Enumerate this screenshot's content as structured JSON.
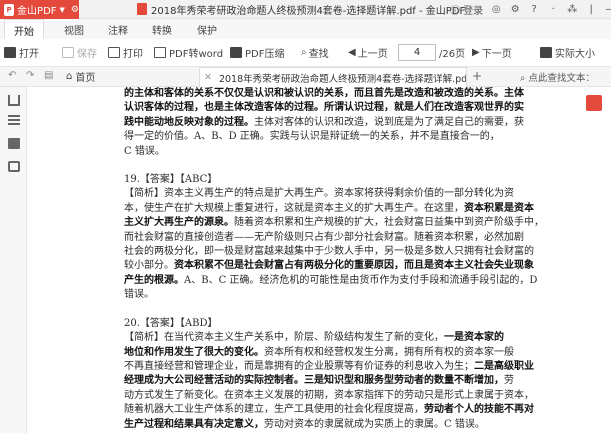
{
  "app": {
    "brand": "金山PDF",
    "window_title": "2018年秀荣考研政治命题人终极预测4套卷-选择题详解.pdf - 金山PDF",
    "login": "登录",
    "window_controls": [
      "◎",
      "⚙",
      "?",
      "·",
      "⁂",
      "|",
      "—",
      "□",
      "✕"
    ]
  },
  "menu": [
    "开始",
    "视图",
    "注释",
    "转换",
    "保护"
  ],
  "toolbar": {
    "open": "打开",
    "save": "保存",
    "print": "打印",
    "pdf2word": "PDF转word",
    "compress": "PDF压缩",
    "find": "查找",
    "prev": "上一页",
    "page_current": "4",
    "page_total": "/26页",
    "next": "下一页",
    "actual_size": "实际大小"
  },
  "tabs": {
    "home": "首页",
    "doc": "2018年秀荣考研政治命题人终极预测4套卷-选择题详解.pdf",
    "search_placeholder": "点此查找文本："
  },
  "document": {
    "q18_cont": [
      {
        "b": "的主体和客体的关系不仅仅是认识和被认识的关系，而且首先是改造和被改造的关系。主体"
      },
      {
        "b": "认识客体的过程，也是主体改造客体的过程。所谓认识过程，就是人们在改造客观世界的实"
      },
      {
        "b": "践中能动地反映对象的过程。",
        "t": "主体对客体的认识和改造，说到底是为了满足自己的需要，获"
      },
      {
        "t": "得一定的价值。A、B、D 正确。实践与认识是辩证统一的关系，并不是直接合一的，"
      },
      {
        "t": "C 错误。"
      }
    ],
    "q19_head": "19.【答案】【ABC】",
    "q19": [
      {
        "t": "【简析】资本主义再生产的特点是扩大再生产。资本家将获得剩余价值的一部分转化为资"
      },
      {
        "t": "本，使生产在扩大规模上重复进行，这就是资本主义的扩大再生产。在这里，",
        "b": "资本积累是资本"
      },
      {
        "b": "主义扩大再生产的源泉。",
        "t": "随着资本积累和生产规模的扩大，社会财富日益集中到资产阶级手中，"
      },
      {
        "t": "而社会财富的直接创造者——无产阶级则只占有少部分社会财富。随着资本积累，必然加剧"
      },
      {
        "t": "社会的两极分化，即一极是财富越来越集中于少数人手中，另一极是多数人只拥有社会财富的"
      },
      {
        "t": "较小部分。",
        "b": "资本积累不但是社会财富占有两极分化的重要原因，而且是资本主义社会失业现象"
      },
      {
        "b": "产生的根源。",
        "t": "A、B、C 正确。经济危机的可能性是由货币作为支付手段和流通手段引起的，D"
      },
      {
        "t": "错误。"
      }
    ],
    "q20_head": "20.【答案】【ABD】",
    "q20": [
      {
        "t": "【简析】在当代资本主义生产关系中，阶层、阶级结构发生了新的变化，",
        "b": "一是资本家的"
      },
      {
        "b": "地位和作用发生了很大的变化。",
        "t": "资本所有权和经营权发生分离，拥有所有权的资本家一般"
      },
      {
        "t": "不再直接经营和管理企业，而是靠拥有的企业股票等有价证券的利息收入为生；",
        "b": "二是高级职业"
      },
      {
        "b": "经理成为大公司经营活动的实际控制者。三是知识型和服务型劳动者的数量不断增加，",
        "t": "劳"
      },
      {
        "t": "动方式发生了新变化。在资本主义发展的初期，资本家指挥下的劳动只是形式上隶属于资本，"
      },
      {
        "t": "随着机器大工业生产体系的建立，生产工具使用的社会化程度提高，",
        "b": "劳动者个人的技能不再对"
      },
      {
        "b": "生产过程和结果具有决定意义，",
        "t": "劳动对资本的隶属就成为实质上的隶属。C 错误。"
      }
    ]
  }
}
